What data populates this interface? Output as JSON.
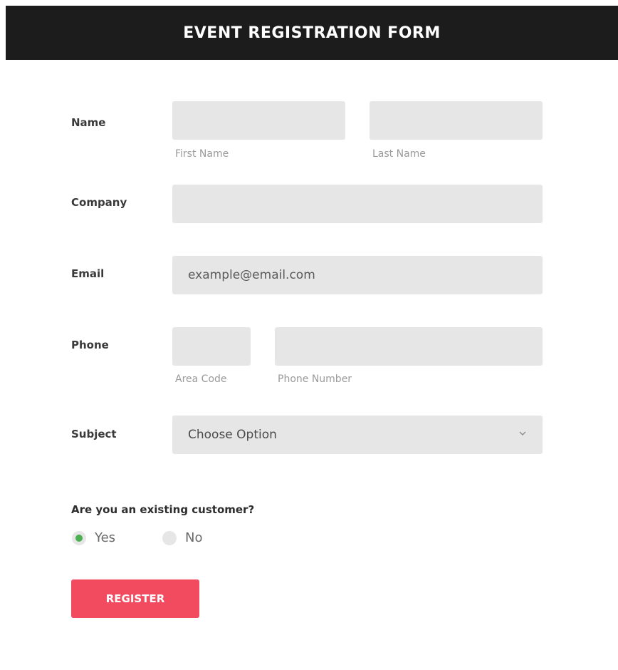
{
  "header": {
    "title": "EVENT REGISTRATION FORM"
  },
  "form": {
    "name": {
      "label": "Name",
      "first_label": "First Name",
      "last_label": "Last Name"
    },
    "company": {
      "label": "Company"
    },
    "email": {
      "label": "Email",
      "placeholder": "example@email.com"
    },
    "phone": {
      "label": "Phone",
      "area_label": "Area Code",
      "number_label": "Phone Number"
    },
    "subject": {
      "label": "Subject",
      "selected": "Choose Option"
    },
    "customer": {
      "question": "Are you an existing customer?",
      "options": [
        {
          "label": "Yes",
          "checked": true
        },
        {
          "label": "No",
          "checked": false
        }
      ]
    },
    "register_label": "REGISTER"
  },
  "colors": {
    "header_bg": "#1c1c1c",
    "field_bg": "#e6e6e6",
    "radio_checked": "#4caf50",
    "button_bg": "#f24a5f"
  }
}
